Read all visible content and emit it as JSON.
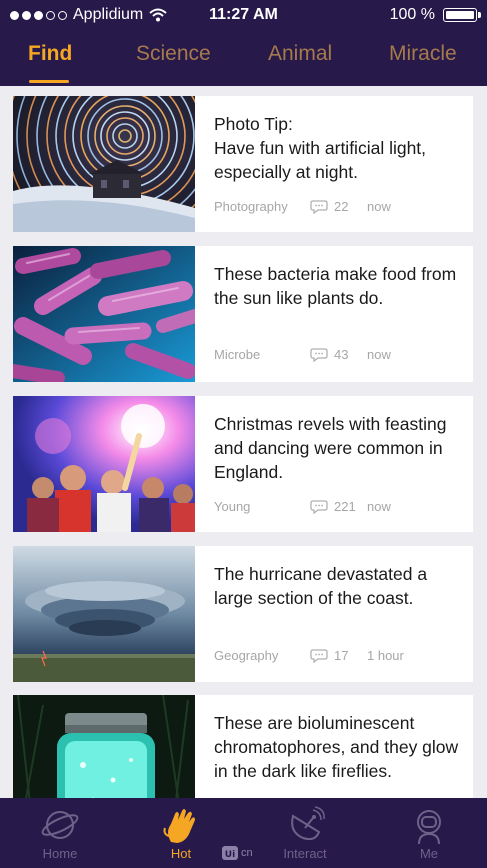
{
  "status_bar": {
    "carrier": "Applidium",
    "time": "11:27 AM",
    "battery": "100 %"
  },
  "tabs": [
    {
      "label": "Find",
      "active": true
    },
    {
      "label": "Science"
    },
    {
      "label": "Animal"
    },
    {
      "label": "Miracle"
    }
  ],
  "cards": [
    {
      "title": "Photo Tip:\nHave fun with artificial light, especially at night.",
      "category": "Photography",
      "comments": "22",
      "time": "now",
      "image": "star-trails-photo"
    },
    {
      "title": "These bacteria make food from the sun like plants do.",
      "category": "Microbe",
      "comments": "43",
      "time": "now",
      "image": "bacteria-photo"
    },
    {
      "title": "Christmas revels with feasting and dancing were common in England.",
      "category": "Young",
      "comments": "221",
      "time": "now",
      "image": "party-photo"
    },
    {
      "title": "The hurricane devastated a large section of the coast.",
      "category": "Geography",
      "comments": "17",
      "time": "1 hour",
      "image": "storm-photo"
    },
    {
      "title": "These are bioluminescent chromatophores, and they glow in the dark like fireflies.",
      "category": "",
      "comments": "",
      "time": "",
      "image": "glowing-jar-photo"
    }
  ],
  "bottom_nav": [
    {
      "label": "Home",
      "icon": "planet-icon"
    },
    {
      "label": "Hot",
      "icon": "flame-hand-icon",
      "active": true
    },
    {
      "label": "Interact",
      "icon": "satellite-dish-icon"
    },
    {
      "label": "Me",
      "icon": "astronaut-icon"
    }
  ],
  "watermark": {
    "badge": "Ui",
    "text": "cn"
  },
  "colors": {
    "header": "#27194a",
    "accent": "#f5a623",
    "tab_inactive": "#a57a4c",
    "nav_inactive": "#6e6289"
  }
}
